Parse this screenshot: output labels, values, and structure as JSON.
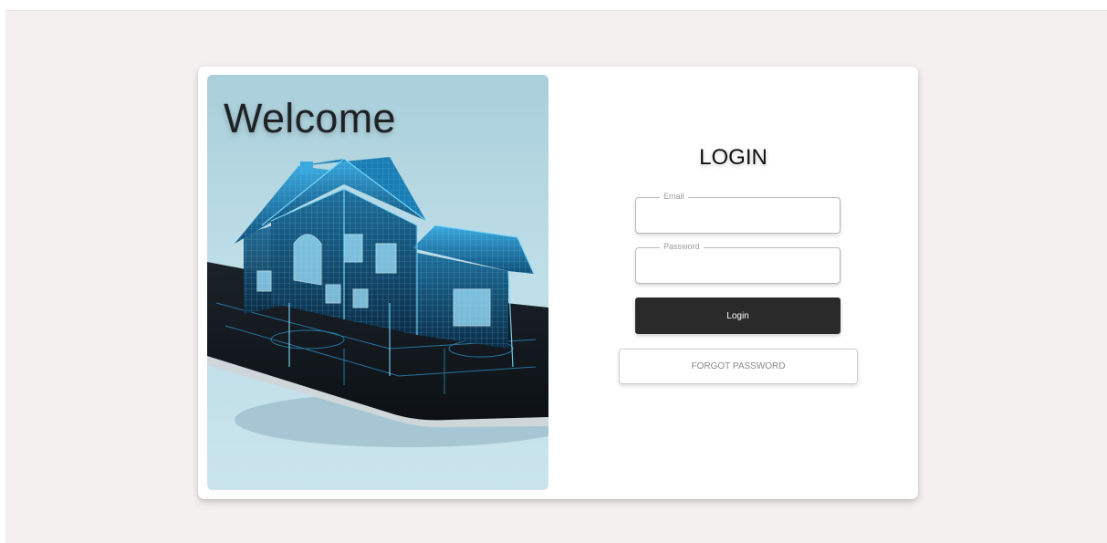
{
  "hero": {
    "welcome_text": "Welcome",
    "image_icon": "house-hologram-on-tablet-image"
  },
  "login": {
    "title": "LOGIN",
    "email_label": "Email",
    "email_value": "",
    "password_label": "Password",
    "password_value": "",
    "login_button_label": "Login",
    "forgot_button_label": "FORGOT PASSWORD"
  },
  "colors": {
    "background": "#f3f0ef",
    "card": "#ffffff",
    "login_button": "#2a2a2a",
    "hologram_blue": "#1e9cd7"
  }
}
